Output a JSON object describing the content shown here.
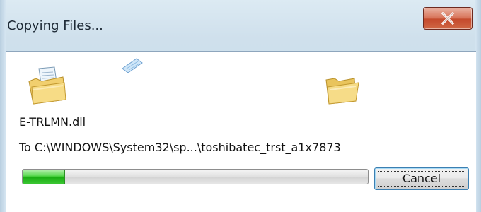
{
  "window": {
    "title": "Copying Files...",
    "close_icon": "close-icon"
  },
  "animation": {
    "source_icon": "folder-with-document-icon",
    "moving_icon": "document-icon",
    "destination_icon": "open-folder-icon"
  },
  "copy": {
    "filename": "E-TRLMN.dll",
    "destination": "To C:\\WINDOWS\\System32\\sp...\\toshibatec_trst_a1x7873",
    "progress_fraction": 0.12
  },
  "buttons": {
    "cancel_label": "Cancel"
  },
  "colors": {
    "progress_green": "#1aae12",
    "close_red": "#c44a2c",
    "frame_blue": "#c6d9e8"
  }
}
